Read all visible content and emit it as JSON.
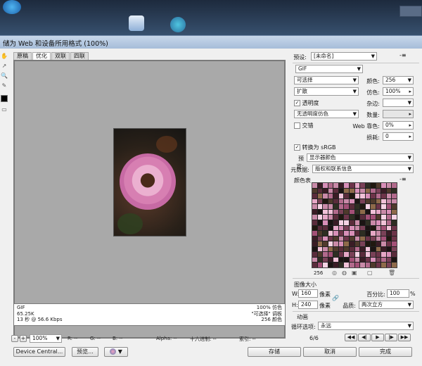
{
  "window": {
    "title": "储为 Web 和设备所用格式 (100%)"
  },
  "tabs": [
    "原稿",
    "优化",
    "双联",
    "四联"
  ],
  "info": {
    "format": "GIF",
    "size": "65.25K",
    "time": "13 秒 @ 56.6 Kbps",
    "dither": "100% 仿色",
    "palette": "\"可选择\" 调板",
    "colors": "256 颜色"
  },
  "zoombar": {
    "zoom": "100%",
    "r": "R: --",
    "g": "G: --",
    "b": "B: --",
    "alpha": "Alpha: --",
    "hex": "十六进制: --",
    "index": "索引: --"
  },
  "buttons": {
    "device_central": "Device Central...",
    "preview": "预览...",
    "save": "存储",
    "cancel": "取消",
    "done": "完成"
  },
  "panel": {
    "preset_label": "预设:",
    "preset_value": "[未命名]",
    "format": "GIF",
    "reduction": "可选择",
    "colors_label": "颜色:",
    "colors_value": "256",
    "dither_algo": "扩散",
    "dither_label": "仿色:",
    "dither_value": "100%",
    "transparency_label": "透明度",
    "matte_label": "杂边:",
    "trans_dither": "无透明度仿色",
    "amount_label": "数量:",
    "interlace_label": "交错",
    "websnap_label": "Web 靠色:",
    "websnap_value": "0%",
    "lossy_label": "损耗:",
    "lossy_value": "0",
    "srgb_label": "转换为 sRGB",
    "preview_label": "预览:",
    "preview_value": "显示器颜色",
    "metadata_label": "元数据:",
    "metadata_value": "版权和联系信息",
    "color_table_label": "颜色表",
    "color_count": "256",
    "image_size_label": "图像大小",
    "w_label": "W:",
    "w_value": "160",
    "h_label": "H:",
    "h_value": "240",
    "pixel_unit": "像素",
    "percent_label": "百分比:",
    "percent_value": "100",
    "quality_label": "品质:",
    "quality_value": "两次立方",
    "animation_label": "动画",
    "loop_label": "循环选项:",
    "loop_value": "永远",
    "frame_counter": "6/6"
  },
  "palette_colors": [
    "#1b1413",
    "#d88fb8",
    "#5a2c3b",
    "#b26a8c",
    "#2e2e22",
    "#f1c2d8",
    "#7a4157",
    "#c98aa8",
    "#3a1c25",
    "#e6a7c6",
    "#4f3a2c",
    "#a35077",
    "#201810",
    "#f5d3e4",
    "#6d3449",
    "#8e6a4a"
  ]
}
